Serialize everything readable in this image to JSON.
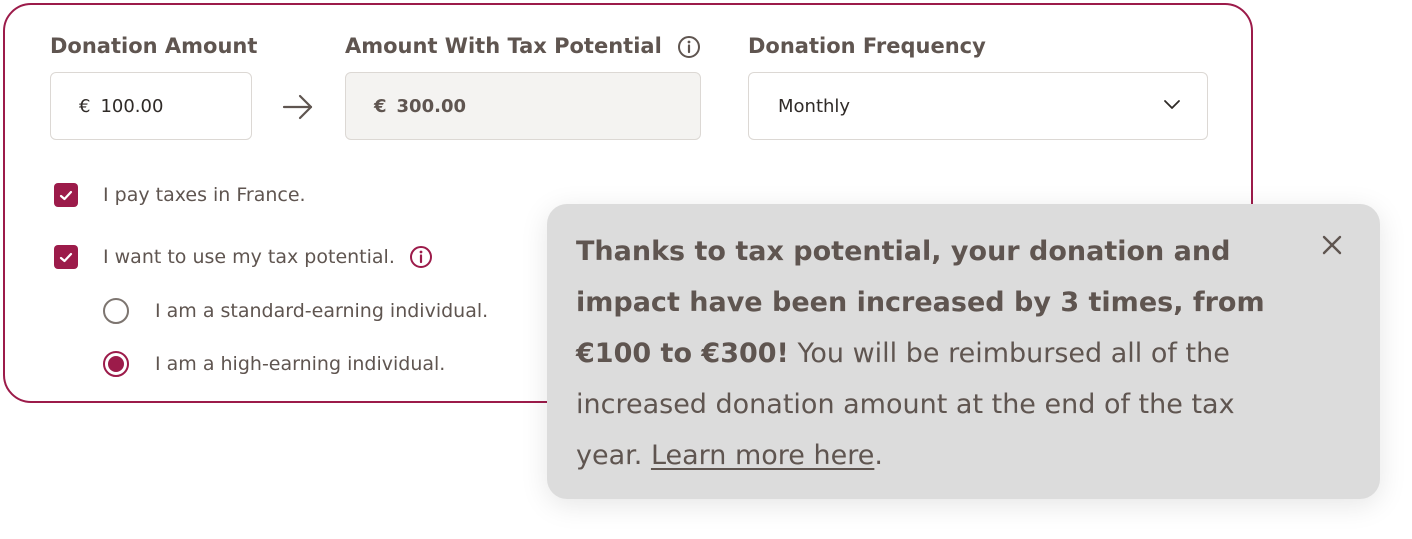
{
  "form": {
    "donation_amount_label": "Donation Amount",
    "donation_amount_currency": "€",
    "donation_amount_value": "100.00",
    "tax_amount_label": "Amount With Tax Potential",
    "tax_amount_currency": "€",
    "tax_amount_value": "300.00",
    "frequency_label": "Donation Frequency",
    "frequency_selected": "Monthly"
  },
  "checkboxes": [
    {
      "label": "I pay taxes in France.",
      "checked": true
    },
    {
      "label": "I want to use my tax potential.",
      "checked": true
    }
  ],
  "radios": [
    {
      "label": "I am a standard-earning individual.",
      "selected": false
    },
    {
      "label": "I am a high-earning individual.",
      "selected": true
    }
  ],
  "tooltip": {
    "bold_text": "Thanks to tax potential, your donation and impact have been increased by 3 times, from €100 to €300!",
    "text": " You will be reimbursed all of the increased donation amount at the end of the tax year. ",
    "link_text": "Learn more here",
    "end_text": "."
  },
  "colors": {
    "accent": "#9c1b4a",
    "text": "#5f5550",
    "tooltip_bg": "#dcdcdc",
    "readonly_bg": "#f4f3f1"
  },
  "icons": [
    "arrow-right-icon",
    "info-icon",
    "chevron-down-icon",
    "check-icon",
    "close-icon"
  ]
}
